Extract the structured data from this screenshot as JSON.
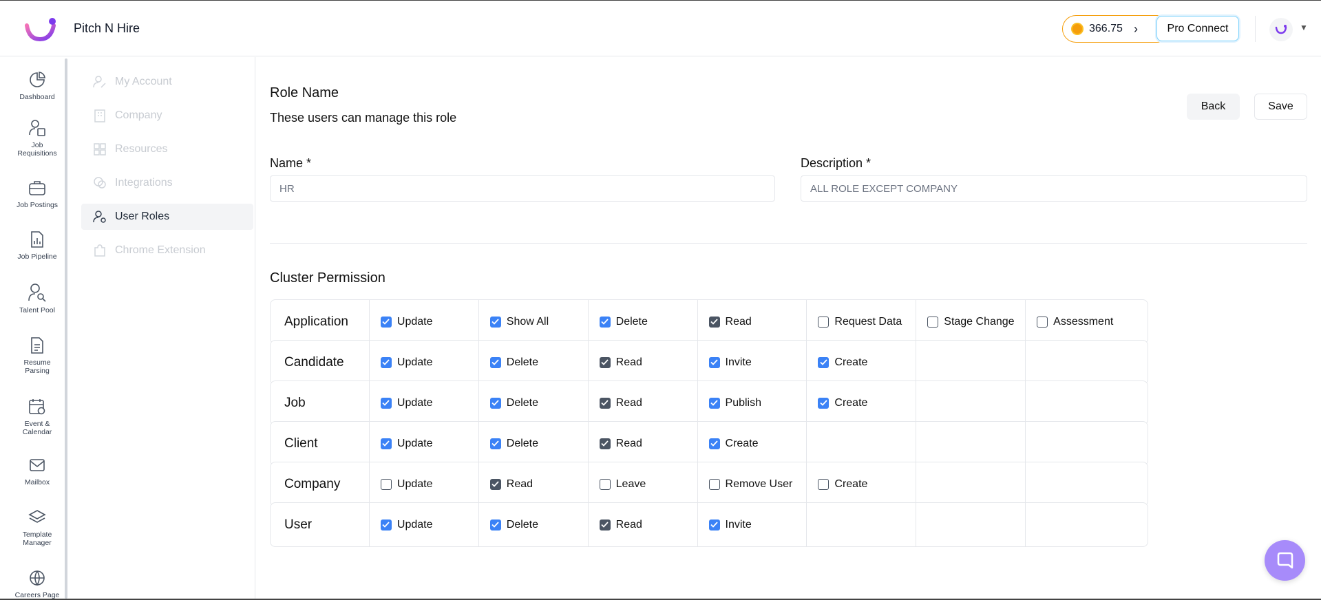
{
  "header": {
    "app_title": "Pitch N Hire",
    "credits": "366.75",
    "pro_connect": "Pro Connect"
  },
  "left_nav": [
    {
      "label": "Dashboard",
      "icon": "dashboard-icon"
    },
    {
      "label": "Job Requisitions",
      "icon": "job-requisitions-icon"
    },
    {
      "label": "Job Postings",
      "icon": "briefcase-icon"
    },
    {
      "label": "Job Pipeline",
      "icon": "pipeline-icon"
    },
    {
      "label": "Talent Pool",
      "icon": "talent-pool-icon"
    },
    {
      "label": "Resume Parsing",
      "icon": "resume-icon"
    },
    {
      "label": "Event & Calendar",
      "icon": "calendar-icon"
    },
    {
      "label": "Mailbox",
      "icon": "mail-icon"
    },
    {
      "label": "Template Manager",
      "icon": "layers-icon"
    },
    {
      "label": "Careers Page",
      "icon": "globe-icon"
    }
  ],
  "settings_menu": [
    {
      "label": "My Account",
      "active": false
    },
    {
      "label": "Company",
      "active": false
    },
    {
      "label": "Resources",
      "active": false
    },
    {
      "label": "Integrations",
      "active": false
    },
    {
      "label": "User Roles",
      "active": true
    },
    {
      "label": "Chrome Extension",
      "active": false
    }
  ],
  "role": {
    "title": "Role Name",
    "subtitle": "These users can manage this role",
    "back_label": "Back",
    "save_label": "Save",
    "name_label": "Name *",
    "name_value": "HR",
    "description_label": "Description *",
    "description_value": "ALL ROLE EXCEPT COMPANY"
  },
  "cluster": {
    "title": "Cluster Permission",
    "rows": [
      {
        "name": "Application",
        "perms": [
          {
            "label": "Update",
            "state": "blue"
          },
          {
            "label": "Show All",
            "state": "blue"
          },
          {
            "label": "Delete",
            "state": "blue"
          },
          {
            "label": "Read",
            "state": "dark"
          },
          {
            "label": "Request Data",
            "state": "off"
          },
          {
            "label": "Stage Change",
            "state": "off"
          },
          {
            "label": "Assessment",
            "state": "off"
          }
        ]
      },
      {
        "name": "Candidate",
        "perms": [
          {
            "label": "Update",
            "state": "blue"
          },
          {
            "label": "Delete",
            "state": "blue"
          },
          {
            "label": "Read",
            "state": "dark"
          },
          {
            "label": "Invite",
            "state": "blue"
          },
          {
            "label": "Create",
            "state": "blue"
          }
        ]
      },
      {
        "name": "Job",
        "perms": [
          {
            "label": "Update",
            "state": "blue"
          },
          {
            "label": "Delete",
            "state": "blue"
          },
          {
            "label": "Read",
            "state": "dark"
          },
          {
            "label": "Publish",
            "state": "blue"
          },
          {
            "label": "Create",
            "state": "blue"
          }
        ]
      },
      {
        "name": "Client",
        "perms": [
          {
            "label": "Update",
            "state": "blue"
          },
          {
            "label": "Delete",
            "state": "blue"
          },
          {
            "label": "Read",
            "state": "dark"
          },
          {
            "label": "Create",
            "state": "blue"
          }
        ]
      },
      {
        "name": "Company",
        "perms": [
          {
            "label": "Update",
            "state": "off"
          },
          {
            "label": "Read",
            "state": "dark"
          },
          {
            "label": "Leave",
            "state": "off"
          },
          {
            "label": "Remove User",
            "state": "off"
          },
          {
            "label": "Create",
            "state": "off"
          }
        ]
      },
      {
        "name": "User",
        "perms": [
          {
            "label": "Update",
            "state": "blue"
          },
          {
            "label": "Delete",
            "state": "blue"
          },
          {
            "label": "Read",
            "state": "dark"
          },
          {
            "label": "Invite",
            "state": "blue"
          }
        ]
      }
    ]
  },
  "colors": {
    "accent_blue": "#3b82f6",
    "checked_dark": "#4b5563",
    "credits_border": "#f59e0b",
    "chat_fab": "#a78bfa"
  }
}
